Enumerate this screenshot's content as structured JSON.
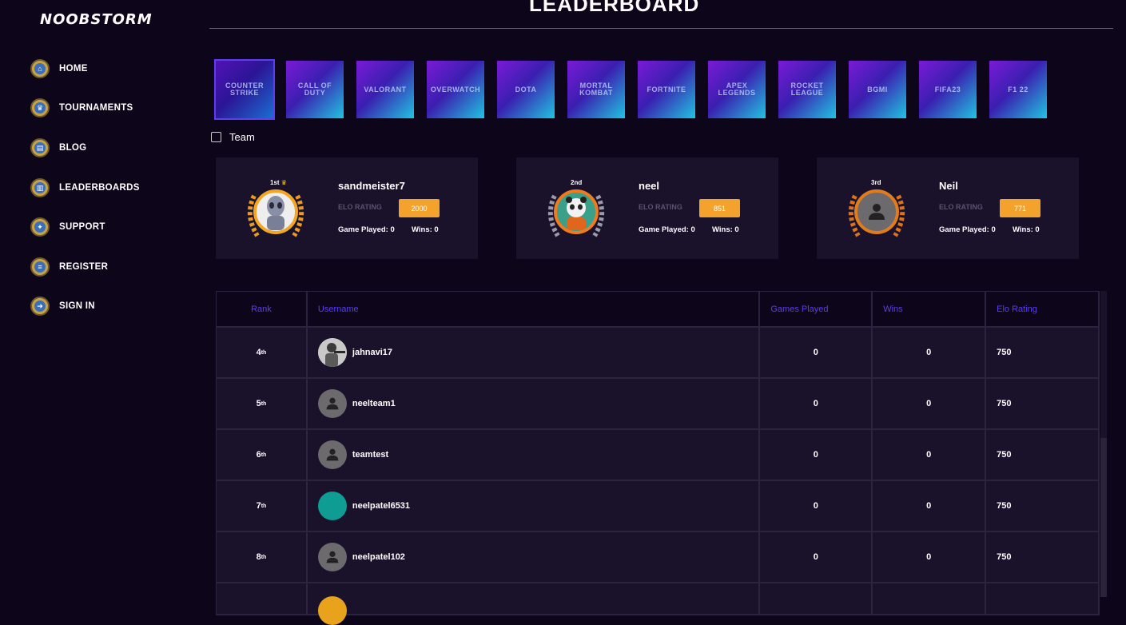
{
  "brand": {
    "logo_text": "NOOBSTORM"
  },
  "sidebar": {
    "items": [
      {
        "label": "HOME",
        "icon": "home-icon"
      },
      {
        "label": "TOURNAMENTS",
        "icon": "trophy-icon"
      },
      {
        "label": "BLOG",
        "icon": "blog-icon"
      },
      {
        "label": "LEADERBOARDS",
        "icon": "leaderboard-icon"
      },
      {
        "label": "SUPPORT",
        "icon": "support-icon"
      },
      {
        "label": "REGISTER",
        "icon": "register-icon"
      },
      {
        "label": "SIGN IN",
        "icon": "sign-in-icon"
      }
    ]
  },
  "page": {
    "title": "LEADERBOARD"
  },
  "games": [
    {
      "label": "COUNTER STRIKE",
      "active": true
    },
    {
      "label": "CALL OF DUTY"
    },
    {
      "label": "VALORANT"
    },
    {
      "label": "OVERWATCH"
    },
    {
      "label": "DOTA"
    },
    {
      "label": "MORTAL KOMBAT"
    },
    {
      "label": "FORTNITE"
    },
    {
      "label": "APEX LEGENDS"
    },
    {
      "label": "ROCKET LEAGUE"
    },
    {
      "label": "BGMI"
    },
    {
      "label": "FIFA23"
    },
    {
      "label": "F1 22"
    }
  ],
  "filter": {
    "team_label": "Team",
    "team_checked": false
  },
  "podium": [
    {
      "place": "1st",
      "username": "sandmeister7",
      "elo_label": "ELO RATING",
      "elo": "2000",
      "played": "Game Played: 0",
      "wins": "Wins: 0",
      "ring_color": "#f2a623"
    },
    {
      "place": "2nd",
      "username": "neel",
      "elo_label": "ELO RATING",
      "elo": "851",
      "played": "Game Played: 0",
      "wins": "Wins: 0",
      "ring_color": "#f07a1e"
    },
    {
      "place": "3rd",
      "username": "Neil",
      "elo_label": "ELO RATING",
      "elo": "771",
      "played": "Game Played: 0",
      "wins": "Wins: 0",
      "ring_color": "#e07c1c"
    }
  ],
  "table": {
    "headers": {
      "rank": "Rank",
      "username": "Username",
      "games": "Games Played",
      "wins": "Wins",
      "elo": "Elo Rating"
    },
    "rows": [
      {
        "rank": "4",
        "suffix": "th",
        "username": "jahnavi17",
        "games": "0",
        "wins": "0",
        "elo": "750"
      },
      {
        "rank": "5",
        "suffix": "th",
        "username": "neelteam1",
        "games": "0",
        "wins": "0",
        "elo": "750"
      },
      {
        "rank": "6",
        "suffix": "th",
        "username": "teamtest",
        "games": "0",
        "wins": "0",
        "elo": "750"
      },
      {
        "rank": "7",
        "suffix": "th",
        "username": "neelpatel6531",
        "games": "0",
        "wins": "0",
        "elo": "750"
      },
      {
        "rank": "8",
        "suffix": "th",
        "username": "neelpatel102",
        "games": "0",
        "wins": "0",
        "elo": "750"
      }
    ]
  },
  "colors": {
    "accent": "#5b3ef0",
    "elo_badge": "#f3a32c",
    "card_bg": "#1a112b",
    "page_bg": "#0d0519"
  }
}
